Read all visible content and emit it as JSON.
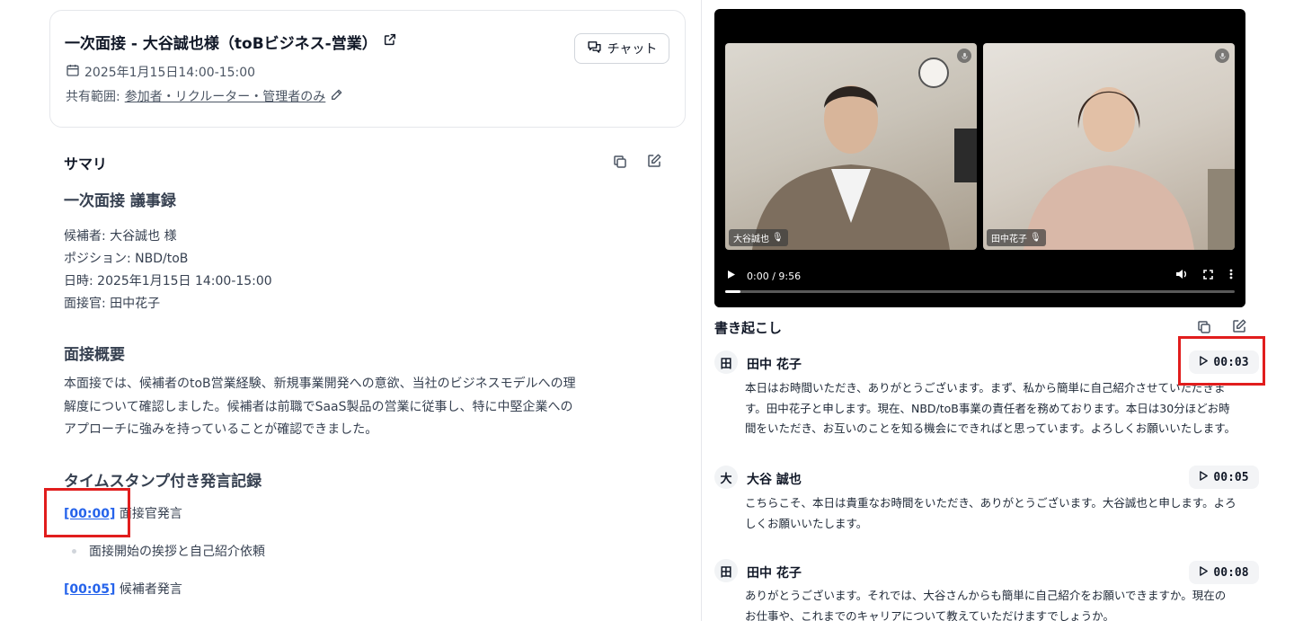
{
  "meeting": {
    "title": "一次面接 - 大谷誠也様（toBビジネス-営業）",
    "date": "2025年1月15日14:00-15:00",
    "share_label": "共有範囲:",
    "share_value": "参加者・リクルーター・管理者のみ",
    "chat_label": "チャット"
  },
  "summary": {
    "heading": "サマリ",
    "minutes_title": "一次面接 議事録",
    "details": [
      {
        "label": "候補者:",
        "value": "大谷誠也 様"
      },
      {
        "label": "ポジション:",
        "value": "NBD/toB"
      },
      {
        "label": "日時:",
        "value": "2025年1月15日 14:00-15:00"
      },
      {
        "label": "面接官:",
        "value": "田中花子"
      }
    ],
    "overview_title": "面接概要",
    "overview_lines": [
      "本面接では、候補者のtoB営業経験、新規事業開発への意欲、当社のビジネスモデルへの理",
      "解度について確認しました。候補者は前職でSaaS製品の営業に従事し、特に中堅企業への",
      "アプローチに強みを持っていることが確認できました。"
    ],
    "timestamp_title": "タイムスタンプ付き発言記録",
    "records": [
      {
        "time": "[00:00]",
        "speaker": "面接官発言",
        "bullet": "面接開始の挨拶と自己紹介依頼"
      },
      {
        "time": "[00:05]",
        "speaker": "候補者発言"
      }
    ]
  },
  "video": {
    "time": "0:00 / 9:56",
    "progress": 0.03,
    "participants": [
      {
        "name": "大谷誠也"
      },
      {
        "name": "田中花子"
      }
    ]
  },
  "transcript": {
    "heading": "書き起こし",
    "entries": [
      {
        "avatar": "田",
        "name": "田中 花子",
        "time": "00:03",
        "lines": [
          "本日はお時間いただき、ありがとうございます。まず、私から簡単に自己紹介させていただきま",
          "す。田中花子と申します。現在、NBD/toB事業の責任者を務めております。本日は30分ほどお時",
          "間をいただき、お互いのことを知る機会にできればと思っています。よろしくお願いいたします。"
        ]
      },
      {
        "avatar": "大",
        "name": "大谷 誠也",
        "time": "00:05",
        "lines": [
          "こちらこそ、本日は貴重なお時間をいただき、ありがとうございます。大谷誠也と申します。よろ",
          "しくお願いいたします。"
        ]
      },
      {
        "avatar": "田",
        "name": "田中 花子",
        "time": "00:08",
        "lines": [
          "ありがとうございます。それでは、大谷さんからも簡単に自己紹介をお願いできますか。現在の",
          "お仕事や、これまでのキャリアについて教えていただけますでしょうか。"
        ]
      }
    ]
  },
  "colors": {
    "highlight": "#e11d1d",
    "link": "#2563eb"
  }
}
